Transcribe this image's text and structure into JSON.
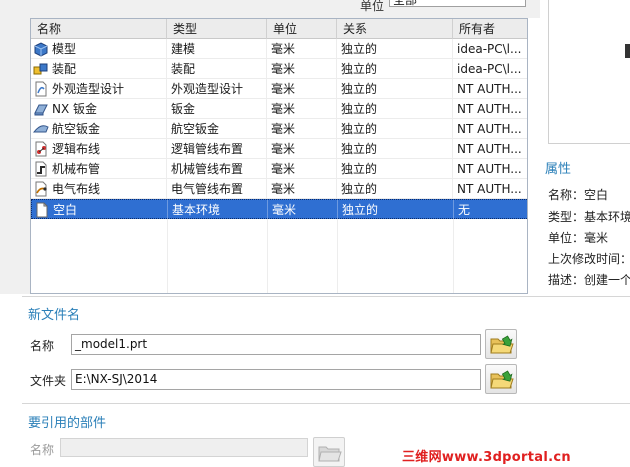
{
  "filter": {
    "label": "单位",
    "value": "全部"
  },
  "table": {
    "columns": [
      "名称",
      "类型",
      "单位",
      "关系",
      "所有者"
    ],
    "rows": [
      {
        "name": "模型",
        "type": "建模",
        "unit": "毫米",
        "relation": "独立的",
        "owner": "idea-PC\\l...",
        "icon": "model-icon"
      },
      {
        "name": "装配",
        "type": "装配",
        "unit": "毫米",
        "relation": "独立的",
        "owner": "idea-PC\\l...",
        "icon": "assembly-icon"
      },
      {
        "name": "外观造型设计",
        "type": "外观造型设计",
        "unit": "毫米",
        "relation": "独立的",
        "owner": "NT AUTH...",
        "icon": "shape-studio-icon"
      },
      {
        "name": "NX 钣金",
        "type": "钣金",
        "unit": "毫米",
        "relation": "独立的",
        "owner": "NT AUTH...",
        "icon": "sheet-metal-icon"
      },
      {
        "name": "航空钣金",
        "type": "航空钣金",
        "unit": "毫米",
        "relation": "独立的",
        "owner": "NT AUTH...",
        "icon": "aero-sheet-metal-icon"
      },
      {
        "name": "逻辑布线",
        "type": "逻辑管线布置",
        "unit": "毫米",
        "relation": "独立的",
        "owner": "NT AUTH...",
        "icon": "logical-routing-icon"
      },
      {
        "name": "机械布管",
        "type": "机械管线布置",
        "unit": "毫米",
        "relation": "独立的",
        "owner": "NT AUTH...",
        "icon": "mechanical-routing-icon"
      },
      {
        "name": "电气布线",
        "type": "电气管线布置",
        "unit": "毫米",
        "relation": "独立的",
        "owner": "NT AUTH...",
        "icon": "electrical-routing-icon"
      },
      {
        "name": "空白",
        "type": "基本环境",
        "unit": "毫米",
        "relation": "独立的",
        "owner": "无",
        "icon": "blank-page-icon"
      }
    ],
    "selected_index": 8
  },
  "properties": {
    "title": "属性",
    "name_label": "名称：",
    "name_value": "空白",
    "type_label": "类型：",
    "type_value": "基本环境",
    "unit_label": "单位：",
    "unit_value": "毫米",
    "modified_label": "上次修改时间：",
    "desc_label": "描述：",
    "desc_value": "创建一个"
  },
  "new_file": {
    "title": "新文件名",
    "name_label": "名称",
    "name_value": "_model1.prt",
    "folder_label": "文件夹",
    "folder_value": "E:\\NX-SJ\\2014"
  },
  "referenced": {
    "title": "要引用的部件",
    "name_label": "名称"
  },
  "watermark": "三维网www.3dportal.cn",
  "colors": {
    "accent": "#2a7fb8",
    "selection": "#2f6fd2",
    "watermark": "#e02020"
  }
}
